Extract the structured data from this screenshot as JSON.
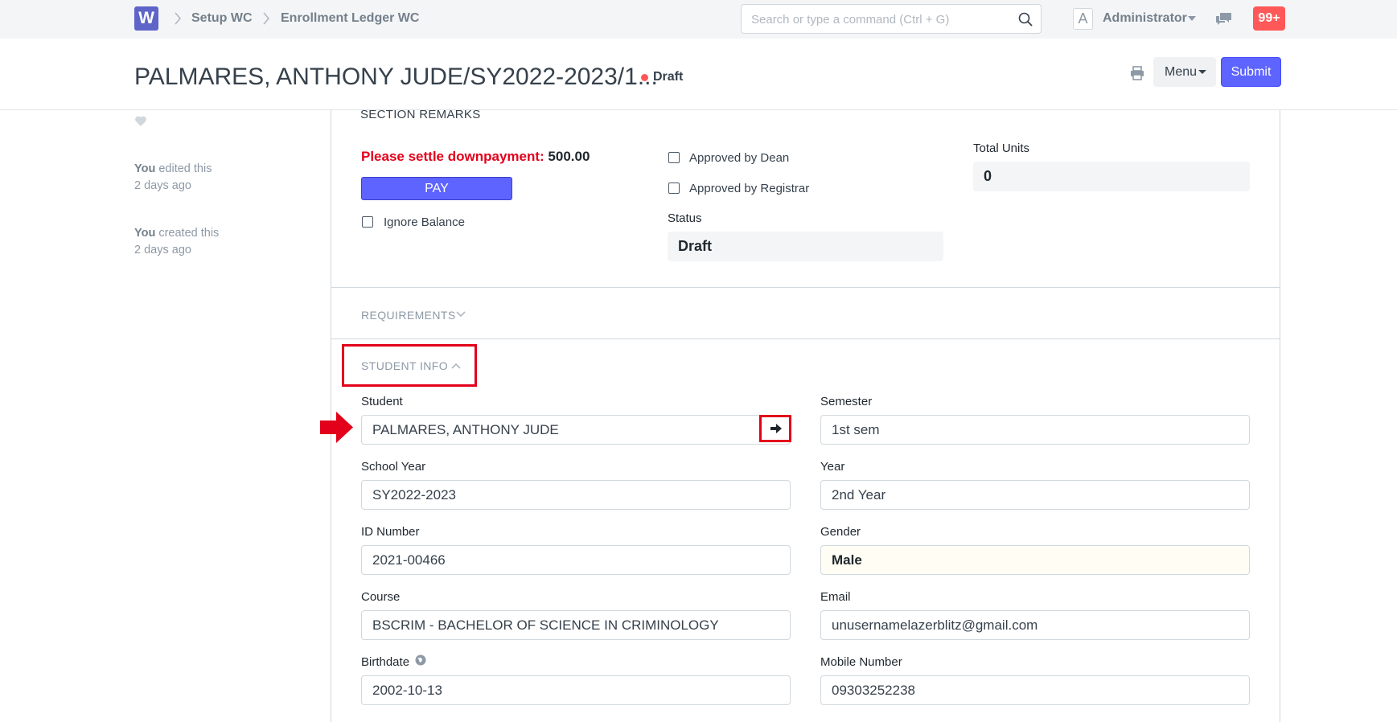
{
  "navbar": {
    "logo_letter": "W",
    "breadcrumbs": [
      "Setup WC",
      "Enrollment Ledger WC"
    ],
    "search_placeholder": "Search or type a command (Ctrl + G)",
    "avatar_letter": "A",
    "user_name": "Administrator",
    "notification_count": "99+"
  },
  "page_head": {
    "title": "PALMARES, ANTHONY JUDE/SY2022-2023/1...",
    "status": "Draft",
    "menu_label": "Menu",
    "submit_label": "Submit"
  },
  "sidebar": {
    "timeline": [
      {
        "actor": "You",
        "action": " edited this",
        "time": "2 days ago"
      },
      {
        "actor": "You",
        "action": " created this",
        "time": "2 days ago"
      }
    ]
  },
  "remarks": {
    "heading": "SECTION REMARKS",
    "settle_text": "Please settle downpayment:",
    "settle_amount": "500.00",
    "pay_label": "PAY",
    "ignore_balance_label": "Ignore Balance",
    "approved_dean_label": "Approved by Dean",
    "approved_registrar_label": "Approved by Registrar",
    "status_label": "Status",
    "status_value": "Draft",
    "total_units_label": "Total Units",
    "total_units_value": "0"
  },
  "sections": {
    "requirements": "REQUIREMENTS",
    "student_info": "STUDENT INFO"
  },
  "student_info": {
    "student": {
      "label": "Student",
      "value": "PALMARES, ANTHONY JUDE"
    },
    "semester": {
      "label": "Semester",
      "value": "1st sem"
    },
    "school_year": {
      "label": "School Year",
      "value": "SY2022-2023"
    },
    "year": {
      "label": "Year",
      "value": "2nd Year"
    },
    "id_number": {
      "label": "ID Number",
      "value": "2021-00466"
    },
    "gender": {
      "label": "Gender",
      "value": "Male"
    },
    "course": {
      "label": "Course",
      "value": "BSCRIM - BACHELOR OF SCIENCE IN CRIMINOLOGY"
    },
    "email": {
      "label": "Email",
      "value": "unusernamelazerblitz@gmail.com"
    },
    "birthdate": {
      "label": "Birthdate",
      "value": "2002-10-13"
    },
    "mobile": {
      "label": "Mobile Number",
      "value": "09303252238"
    }
  },
  "colors": {
    "primary": "#5e64ff",
    "danger": "#e2001a",
    "notification": "#ff5858"
  }
}
